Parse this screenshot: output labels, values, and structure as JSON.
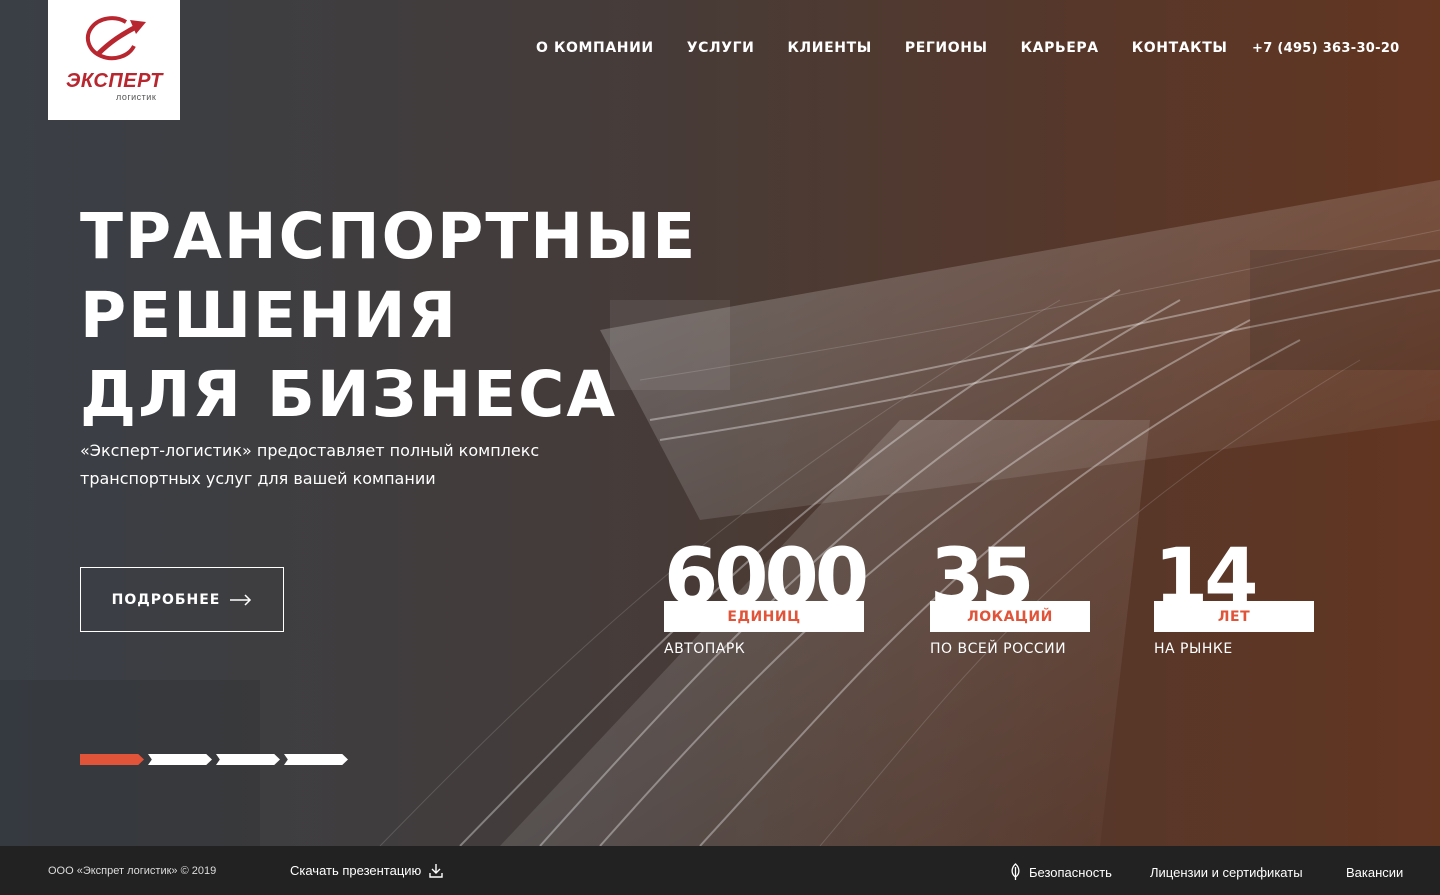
{
  "logo": {
    "title": "ЭКСПЕРТ",
    "subtitle": "логистик"
  },
  "nav": {
    "items": [
      {
        "label": "О КОМПАНИИ"
      },
      {
        "label": "УСЛУГИ"
      },
      {
        "label": "КЛИЕНТЫ"
      },
      {
        "label": "РЕГИОНЫ"
      },
      {
        "label": "КАРЬЕРА"
      },
      {
        "label": "КОНТАКТЫ"
      }
    ],
    "phone": "+7 (495) 363-30-20"
  },
  "hero": {
    "headline_line1": "ТРАНСПОРТНЫЕ РЕШЕНИЯ",
    "headline_line2": "ДЛЯ БИЗНЕСА",
    "subtext_line1": "«Эксперт-логистик» предоставляет полный комплекс",
    "subtext_line2": "транспортных услуг для вашей компании",
    "more_button": "ПОДРОБНЕЕ"
  },
  "stats": [
    {
      "number": "6000",
      "unit": "ЕДИНИЦ",
      "label": "АВТОПАРК"
    },
    {
      "number": "35",
      "unit": "ЛОКАЦИЙ",
      "label": "ПО ВСЕЙ РОССИИ"
    },
    {
      "number": "14",
      "unit": "ЛЕТ",
      "label": "НА РЫНКЕ"
    }
  ],
  "slider": {
    "slides": 4,
    "active_index": 0
  },
  "footer": {
    "copyright": "ООО «Экспрет логистик» © 2019",
    "download_label": "Скачать презентацию",
    "links": [
      {
        "label": "Безопасность",
        "icon": "leaf-icon"
      },
      {
        "label": "Лицензии и сертификаты"
      },
      {
        "label": "Вакансии"
      }
    ]
  },
  "colors": {
    "accent": "#e2543a",
    "brand_red": "#b8262f",
    "footer_bg": "#222222",
    "gradient_left": "#3f454c",
    "gradient_right": "#6c3b25"
  }
}
